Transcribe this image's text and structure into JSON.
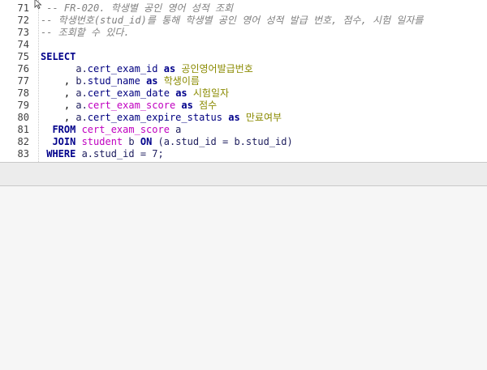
{
  "editor": {
    "lines": [
      {
        "n": "71",
        "segments": [
          {
            "t": " -- FR-020. 학생별 공인 영어 성적 조회",
            "c": "comment"
          }
        ]
      },
      {
        "n": "72",
        "segments": [
          {
            "t": "-- 학생번호(stud_id)를 통해 학생별 공인 영어 성적 발급 번호, 점수, 시험 일자를",
            "c": "comment"
          }
        ]
      },
      {
        "n": "73",
        "segments": [
          {
            "t": "-- 조회할 수 있다.",
            "c": "comment"
          }
        ]
      },
      {
        "n": "74",
        "segments": []
      },
      {
        "n": "75",
        "segments": [
          {
            "t": "SELECT",
            "c": "kw"
          }
        ]
      },
      {
        "n": "76",
        "segments": [
          {
            "t": "      a.",
            "c": "ident"
          },
          {
            "t": "cert_exam_id",
            "c": "id"
          },
          {
            "t": " ",
            "c": "op"
          },
          {
            "t": "as",
            "c": "kw"
          },
          {
            "t": " 공인영어발급번호",
            "c": "alias"
          }
        ]
      },
      {
        "n": "77",
        "segments": [
          {
            "t": "    , ",
            "c": "op"
          },
          {
            "t": "b.",
            "c": "ident"
          },
          {
            "t": "stud_name",
            "c": "id"
          },
          {
            "t": " ",
            "c": "op"
          },
          {
            "t": "as",
            "c": "kw"
          },
          {
            "t": " 학생이름",
            "c": "alias"
          }
        ]
      },
      {
        "n": "78",
        "segments": [
          {
            "t": "    , ",
            "c": "op"
          },
          {
            "t": "a.",
            "c": "ident"
          },
          {
            "t": "cert_exam_date",
            "c": "id"
          },
          {
            "t": " ",
            "c": "op"
          },
          {
            "t": "as",
            "c": "kw"
          },
          {
            "t": " 시험일자",
            "c": "alias"
          }
        ]
      },
      {
        "n": "79",
        "segments": [
          {
            "t": "    , ",
            "c": "op"
          },
          {
            "t": "a.",
            "c": "ident"
          },
          {
            "t": "cert_exam_score",
            "c": "pink"
          },
          {
            "t": " ",
            "c": "op"
          },
          {
            "t": "as",
            "c": "kw"
          },
          {
            "t": " 점수",
            "c": "alias"
          }
        ]
      },
      {
        "n": "80",
        "segments": [
          {
            "t": "    , ",
            "c": "op"
          },
          {
            "t": "a.",
            "c": "ident"
          },
          {
            "t": "cert_exam_expire_status",
            "c": "id"
          },
          {
            "t": " ",
            "c": "op"
          },
          {
            "t": "as",
            "c": "kw"
          },
          {
            "t": " 만료여부",
            "c": "alias"
          }
        ]
      },
      {
        "n": "81",
        "segments": [
          {
            "t": "  ",
            "c": "op"
          },
          {
            "t": "FROM",
            "c": "kw"
          },
          {
            "t": " cert_exam_score",
            "c": "pink"
          },
          {
            "t": " a",
            "c": "ident"
          }
        ]
      },
      {
        "n": "82",
        "segments": [
          {
            "t": "  ",
            "c": "op"
          },
          {
            "t": "JOIN",
            "c": "kw"
          },
          {
            "t": " student",
            "c": "pink"
          },
          {
            "t": " b ",
            "c": "ident"
          },
          {
            "t": "ON",
            "c": "kw"
          },
          {
            "t": " (a.stud_id = b.stud_id)",
            "c": "ident"
          }
        ]
      },
      {
        "n": "83",
        "segments": [
          {
            "t": " ",
            "c": "op"
          },
          {
            "t": "WHERE",
            "c": "kw"
          },
          {
            "t": " a.stud_id = 7;",
            "c": "ident"
          }
        ]
      }
    ]
  },
  "icons": {
    "cursor": "mouse-pointer-icon"
  }
}
